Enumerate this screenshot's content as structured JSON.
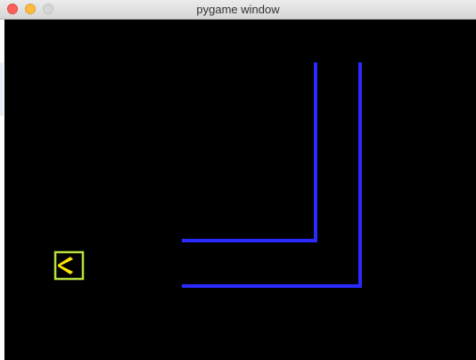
{
  "window": {
    "title": "pygame window"
  },
  "colors": {
    "background": "#000000",
    "wall": "#2a2aff",
    "pacman": "#ffe600",
    "pacman_box": "#b8e040"
  },
  "icons": {
    "close": "close-traffic-light-icon",
    "minimize": "minimize-traffic-light-icon",
    "zoom": "zoom-traffic-light-icon",
    "player": "pacman-icon"
  }
}
